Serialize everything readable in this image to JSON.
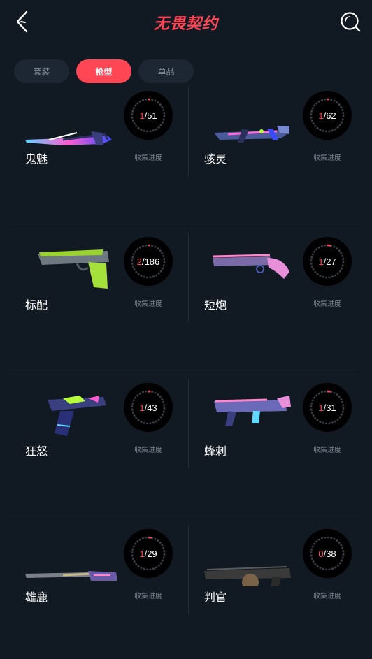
{
  "header": {
    "brand_title": "无畏契约"
  },
  "tabs": [
    {
      "label": "套装",
      "active": false
    },
    {
      "label": "枪型",
      "active": true
    },
    {
      "label": "单品",
      "active": false
    }
  ],
  "colors": {
    "accent": "#ff4655",
    "background": "#111923",
    "ring_track": "#3a3f46"
  },
  "weapons": [
    {
      "name": "鬼魅",
      "owned": "1",
      "total": "/51",
      "progress": 0.0196,
      "progress_label": "收集进度",
      "icon": "ghost-pistol-skin"
    },
    {
      "name": "骇灵",
      "owned": "1",
      "total": "/62",
      "progress": 0.0161,
      "progress_label": "收集进度",
      "icon": "spectre-smg-skin"
    },
    {
      "name": "标配",
      "owned": "2",
      "total": "/186",
      "progress": 0.0108,
      "progress_label": "收集进度",
      "icon": "classic-pistol-skin"
    },
    {
      "name": "短炮",
      "owned": "1",
      "total": "/27",
      "progress": 0.037,
      "progress_label": "收集进度",
      "icon": "shorty-shotgun-skin"
    },
    {
      "name": "狂怒",
      "owned": "1",
      "total": "/43",
      "progress": 0.0233,
      "progress_label": "收集进度",
      "icon": "frenzy-pistol-skin"
    },
    {
      "name": "蜂刺",
      "owned": "1",
      "total": "/31",
      "progress": 0.0323,
      "progress_label": "收集进度",
      "icon": "stinger-smg-skin"
    },
    {
      "name": "雄鹿",
      "owned": "1",
      "total": "/29",
      "progress": 0.0345,
      "progress_label": "收集进度",
      "icon": "bucky-shotgun-skin"
    },
    {
      "name": "判官",
      "owned": "0",
      "total": "/38",
      "progress": 0.0,
      "progress_label": "收集进度",
      "icon": "judge-shotgun-skin"
    }
  ]
}
